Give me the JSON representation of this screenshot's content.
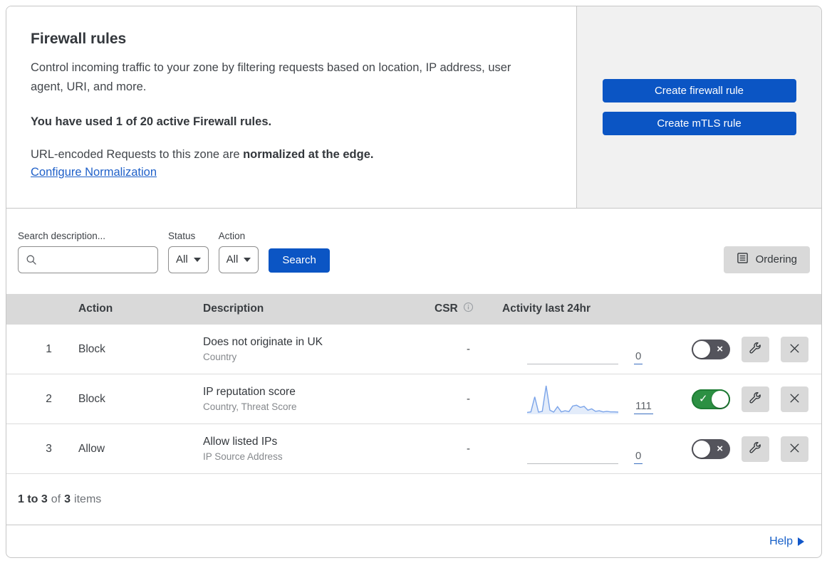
{
  "colors": {
    "accent_blue": "#0b55c4",
    "link_blue": "#2061c9",
    "toggle_on_green": "#2c9043",
    "toggle_off_gray": "#54545c",
    "table_header_gray": "#d9d9d9",
    "side_panel_gray": "#f1f1f1",
    "sparkline_stroke": "#7ba4e9",
    "sparkline_fill": "#e3ecfa"
  },
  "icons": {
    "toggle_check": "✓",
    "toggle_cross": "×"
  },
  "header": {
    "title": "Firewall rules",
    "description": "Control incoming traffic to your zone by filtering requests based on location, IP address, user agent, URI, and more.",
    "usage": "You have used 1 of 20 active Firewall rules.",
    "norm_prefix": "URL-encoded Requests to this zone are ",
    "norm_bold": "normalized at the edge.",
    "norm_link": "Configure Normalization",
    "buttons": [
      {
        "label": "Create firewall rule"
      },
      {
        "label": "Create mTLS rule"
      }
    ]
  },
  "filters": {
    "search_label": "Search description...",
    "status_label": "Status",
    "status_value": "All",
    "action_label": "Action",
    "action_value": "All",
    "search_button": "Search",
    "ordering_label": "Ordering"
  },
  "table": {
    "columns": [
      "Action",
      "Description",
      "CSR",
      "Activity last 24hr"
    ],
    "rows": [
      {
        "priority": "1",
        "action": "Block",
        "description": "Does not originate in UK",
        "fields": "Country",
        "csr": "-",
        "activity_count": "0",
        "enabled": false
      },
      {
        "priority": "2",
        "action": "Block",
        "description": "IP reputation score",
        "fields": "Country, Threat Score",
        "csr": "-",
        "activity_count": "111",
        "enabled": true,
        "sparkline": [
          4,
          6,
          60,
          5,
          8,
          100,
          12,
          5,
          25,
          6,
          10,
          7,
          27,
          30,
          22,
          26,
          12,
          17,
          8,
          10,
          6,
          8,
          6,
          6,
          5
        ]
      },
      {
        "priority": "3",
        "action": "Allow",
        "description": "Allow listed IPs",
        "fields": "IP Source Address",
        "csr": "-",
        "activity_count": "0",
        "enabled": false
      }
    ]
  },
  "footer": {
    "range_bold": "1 to 3",
    "of_word": "of",
    "total_bold": "3",
    "items_word": "items",
    "help_label": "Help"
  }
}
